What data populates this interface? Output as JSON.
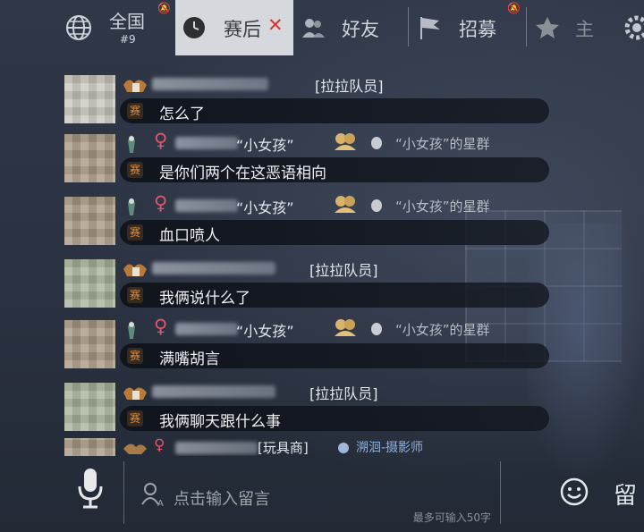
{
  "tabs": {
    "all": {
      "label": "全国",
      "sub": "#9"
    },
    "after": {
      "label": "赛后",
      "close": "✕"
    },
    "friends": {
      "label": "好友"
    },
    "recruit": {
      "label": "招募"
    },
    "extra": {
      "label": "主"
    }
  },
  "messages": [
    {
      "title": "[拉拉队员]",
      "tag": "赛",
      "text": "怎么了"
    },
    {
      "title": "“小女孩”",
      "group": "“小女孩”的星群",
      "tag": "赛",
      "text": "是你们两个在这恶语相向"
    },
    {
      "title": "“小女孩”",
      "group": "“小女孩”的星群",
      "tag": "赛",
      "text": "血口喷人"
    },
    {
      "title": "[拉拉队员]",
      "tag": "赛",
      "text": "我俩说什么了"
    },
    {
      "title": "“小女孩”",
      "group": "“小女孩”的星群",
      "tag": "赛",
      "text": "满嘴胡言"
    },
    {
      "title": "[拉拉队员]",
      "tag": "赛",
      "text": "我俩聊天跟什么事"
    },
    {
      "title": "[玩具商]",
      "group": "溯洄-摄影师"
    }
  ],
  "input": {
    "placeholder": "点击输入留言",
    "limit": "最多可输入50字",
    "send_label": "留"
  },
  "colors": {
    "accent_tag": "#e08d3c",
    "female": "#e0566c",
    "active_tab": "#d5d8dd"
  }
}
